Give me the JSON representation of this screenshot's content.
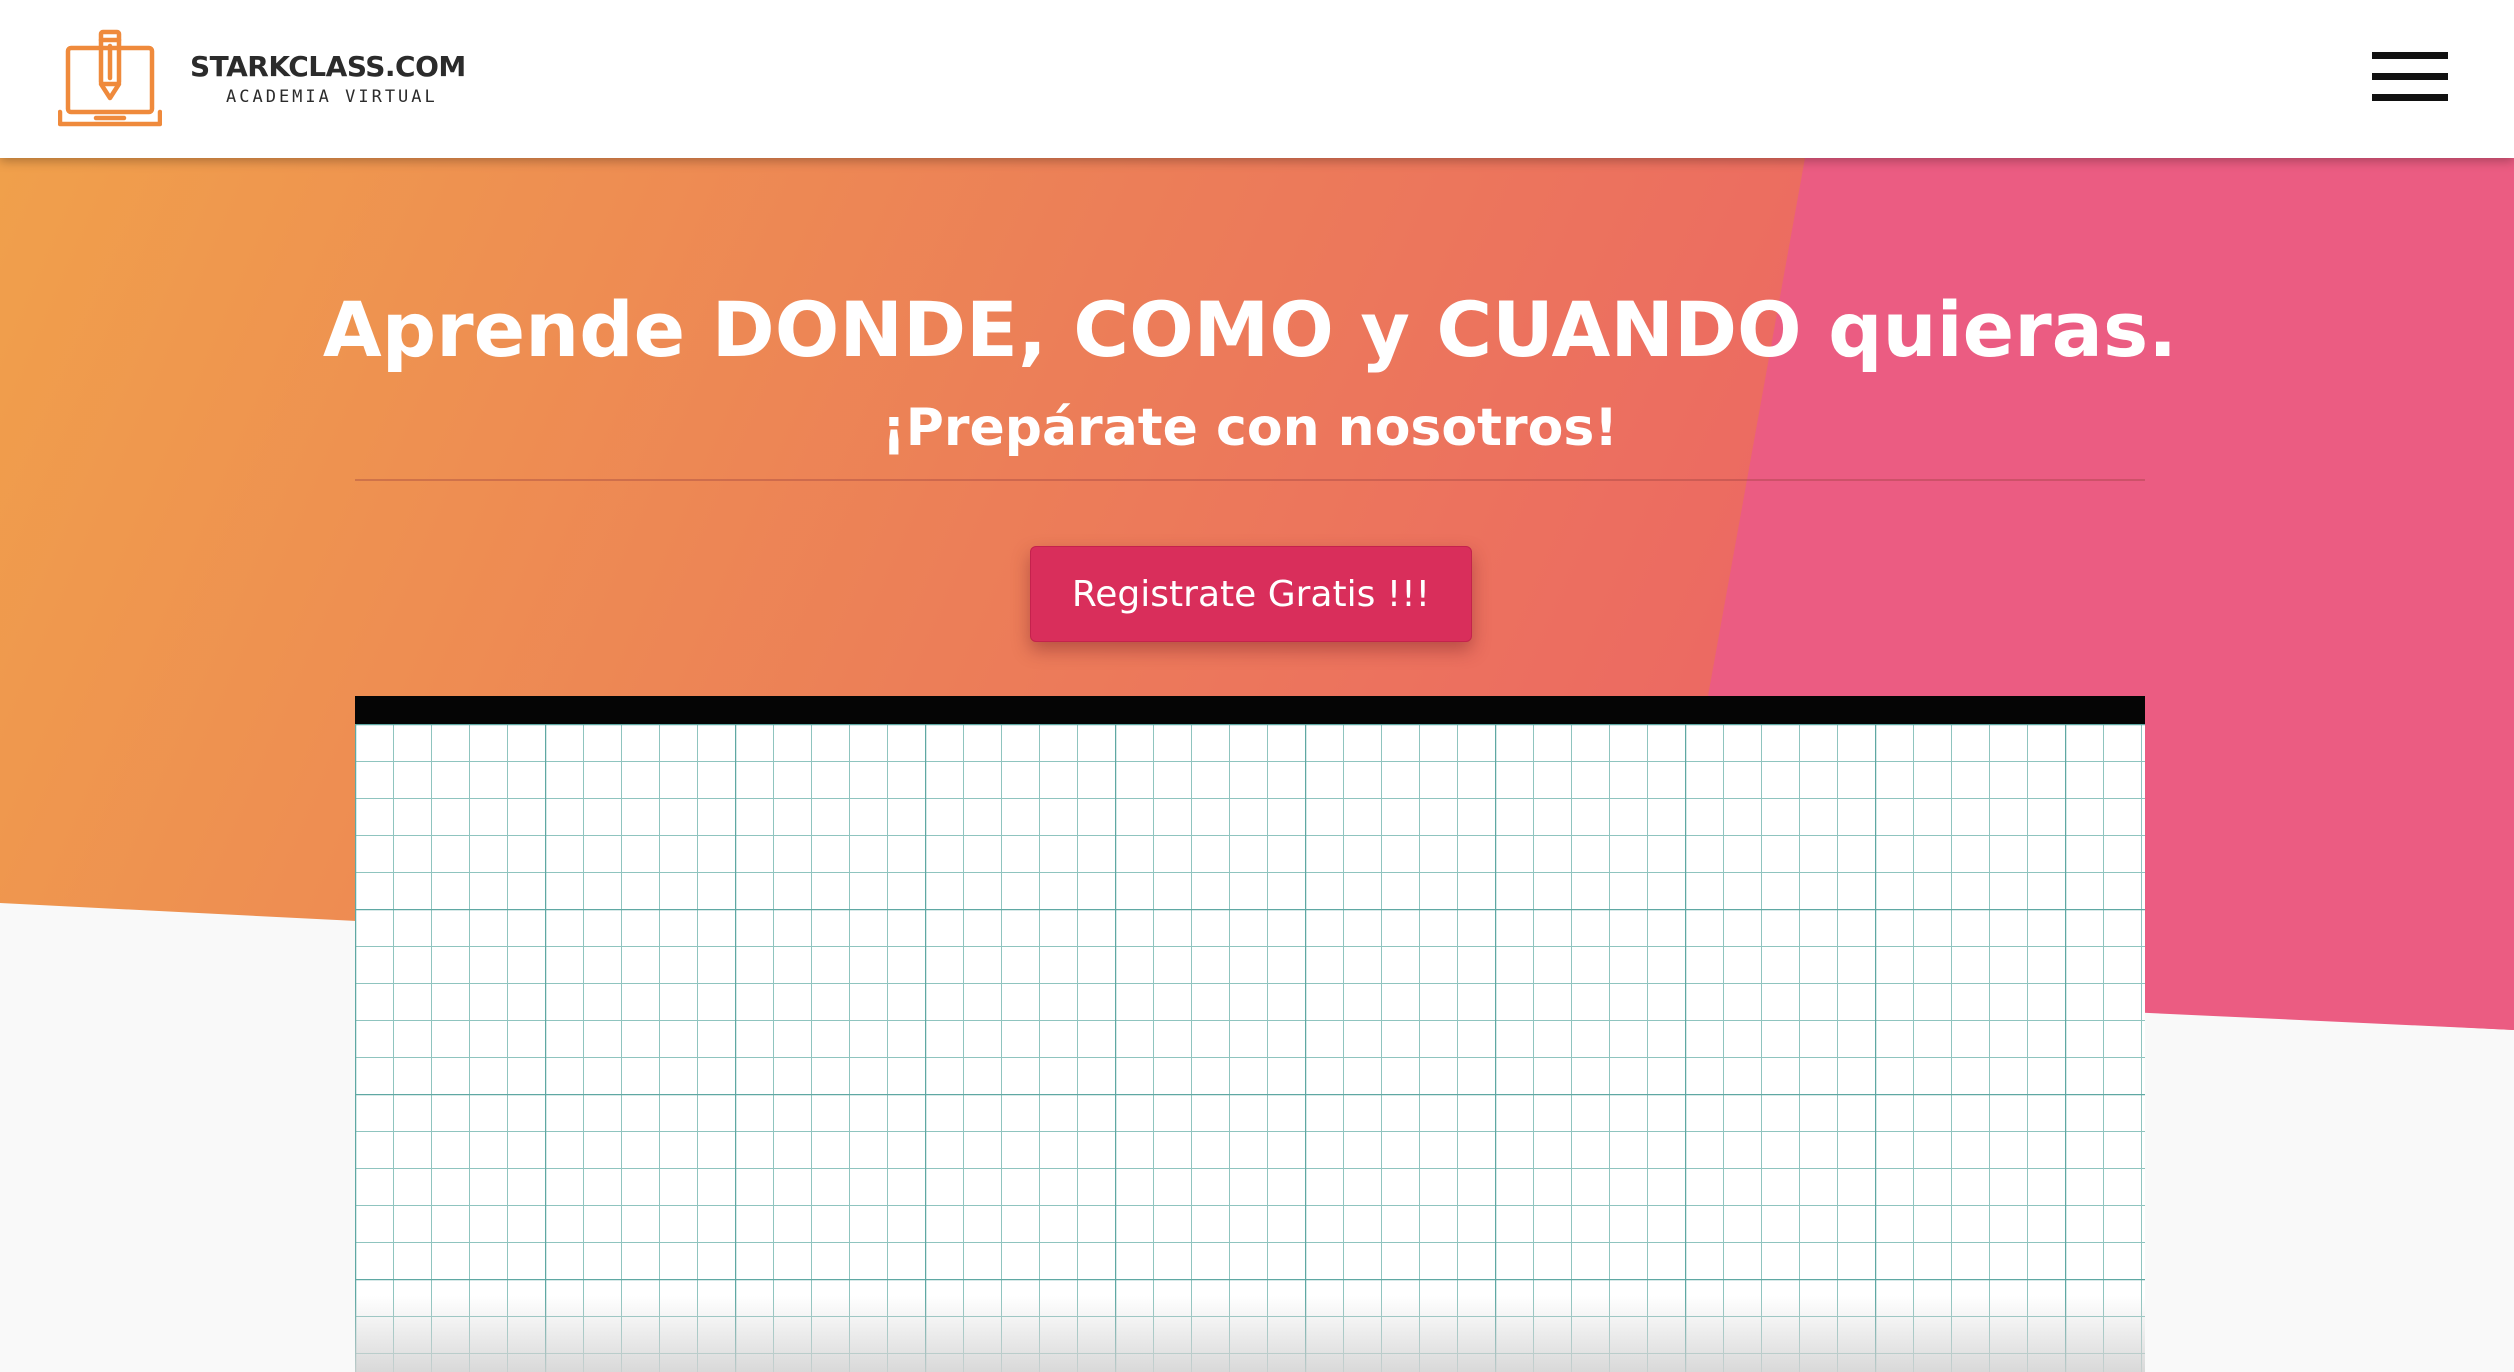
{
  "header": {
    "logo": {
      "name": "STARKCLASS.COM",
      "tagline": "ACADEMIA VIRTUAL",
      "icon": "laptop-pencil-icon"
    },
    "menu_icon": "hamburger-menu-icon"
  },
  "hero": {
    "title": "Aprende DONDE, COMO y CUANDO quieras.",
    "subtitle": "¡Prepárate con nosotros!",
    "cta_label": "Registrate Gratis !!!"
  },
  "colors": {
    "orange": "#f0a04b",
    "coral": "#ec6a62",
    "pink": "#eb5c82",
    "cta": "#d92e5b",
    "logo_orange": "#ef8a3c",
    "grid_line": "#5fa8a3"
  }
}
